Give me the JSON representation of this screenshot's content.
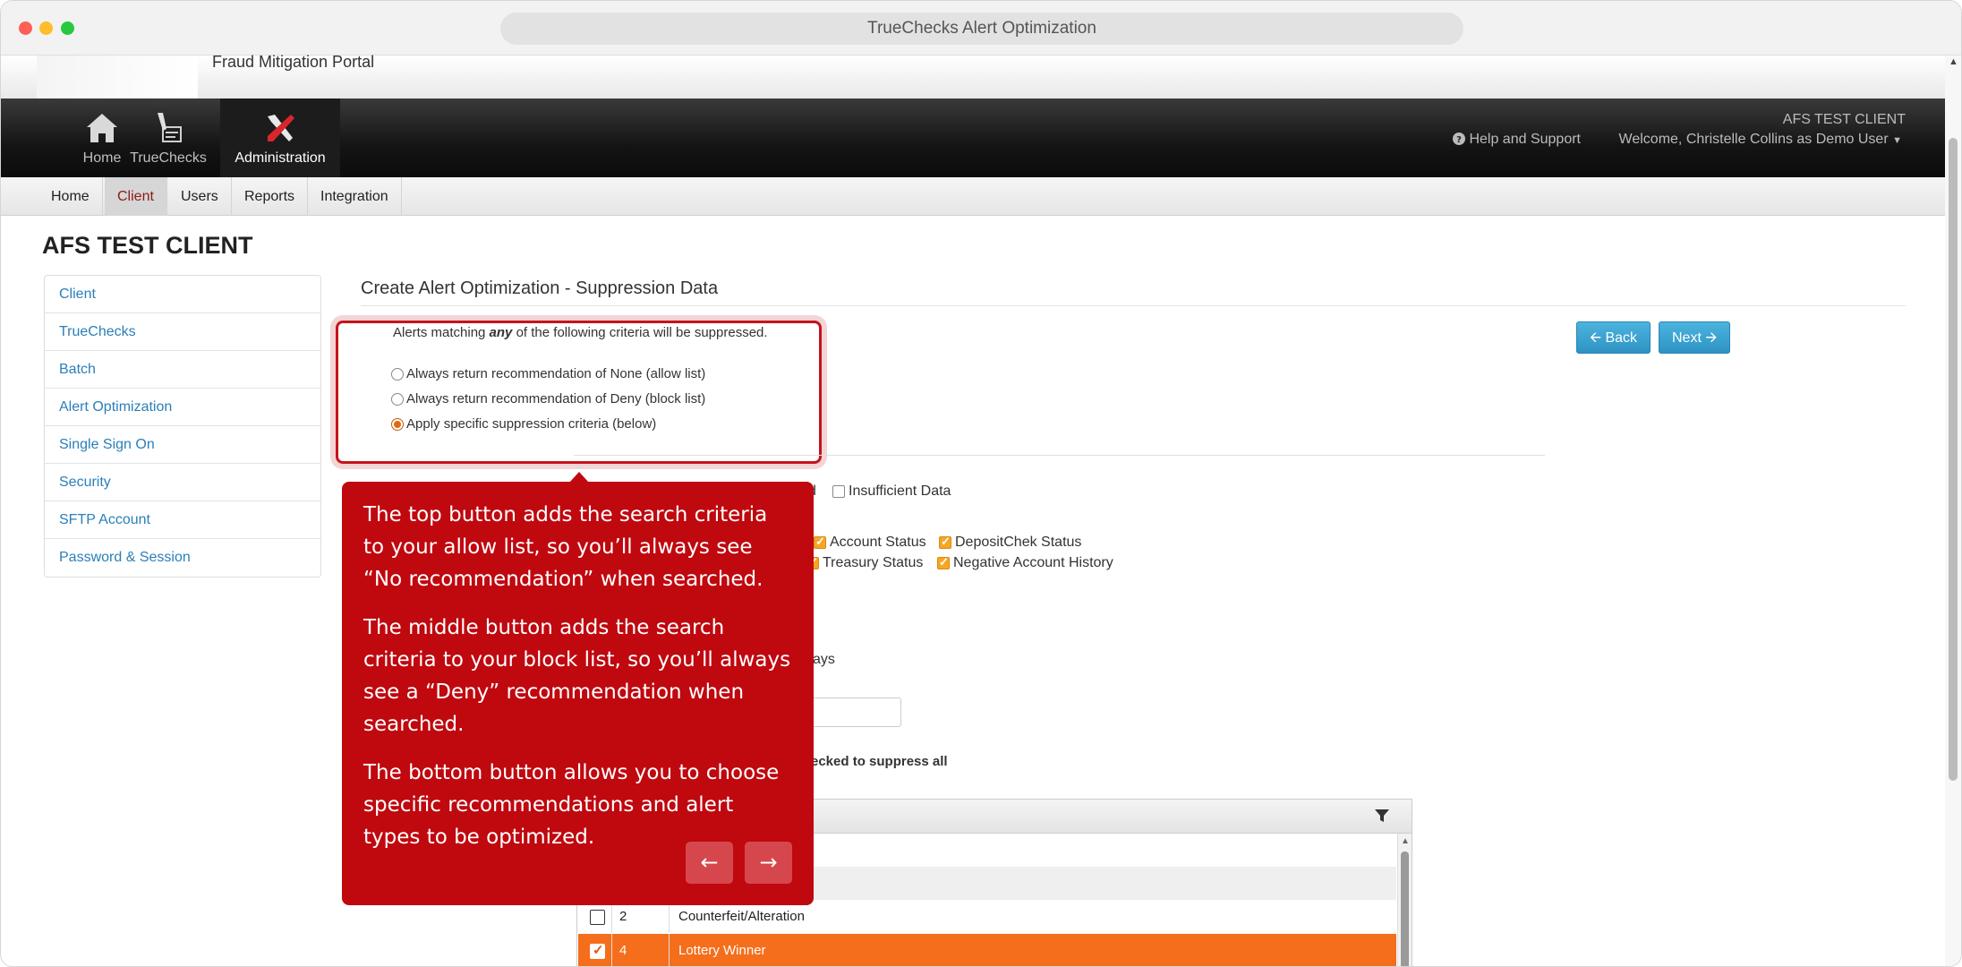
{
  "browser": {
    "title": "TrueChecks Alert Optimization"
  },
  "portal": {
    "name": "Fraud Mitigation Portal"
  },
  "topnav": {
    "items": [
      {
        "label": "Home",
        "icon": "home-icon"
      },
      {
        "label": "TrueChecks",
        "icon": "check-pen-icon"
      },
      {
        "label": "Administration",
        "icon": "tools-icon"
      }
    ],
    "client_name": "AFS TEST CLIENT",
    "help": "Help and Support",
    "welcome": "Welcome, Christelle Collins as Demo User"
  },
  "subnav": {
    "tabs": [
      "Home",
      "Client",
      "Users",
      "Reports",
      "Integration"
    ],
    "active": "Client"
  },
  "page": {
    "client_title": "AFS TEST CLIENT"
  },
  "sidebar": {
    "items": [
      "Client",
      "TrueChecks",
      "Batch",
      "Alert Optimization",
      "Single Sign On",
      "Security",
      "SFTP Account",
      "Password & Session"
    ]
  },
  "main": {
    "section_title": "Create Alert Optimization - Suppression Data",
    "criteria_note_prefix": "Alerts matching ",
    "criteria_note_em": "any",
    "criteria_note_suffix": " of the following criteria will be suppressed.",
    "radio_options": [
      {
        "label": "Always return recommendation of None (allow list)",
        "checked": false
      },
      {
        "label": "Always return recommendation of Deny (block list)",
        "checked": false
      },
      {
        "label": "Apply specific suppression criteria (below)",
        "checked": true
      }
    ],
    "back_label": "Back",
    "next_label": "Next",
    "fragments": {
      "d_suffix": "d",
      "insufficient_data": "Insufficient Data",
      "account_status": "Account Status",
      "depositchek_status": "DepositChek Status",
      "treasury_status": "Treasury Status",
      "negative_account_history": "Negative Account History",
      "days_suffix": "ays",
      "suppress_all_note": "ecked to suppress all"
    },
    "grid_rows": [
      {
        "code": "2",
        "name": "Counterfeit/Alteration",
        "checked": false
      },
      {
        "code": "4",
        "name": "Lottery Winner",
        "checked": true
      }
    ]
  },
  "tooltip": {
    "paragraphs": [
      "The top button adds the search criteria to your allow list, so you’ll always see “No recommendation” when searched.",
      "The middle button adds the search criteria to your block list, so you’ll always see a “Deny” recommendation when searched.",
      "The bottom button allows you to choose specific recommendations and alert types to be optimized."
    ],
    "prev_icon": "arrow-left-icon",
    "next_icon": "arrow-right-icon"
  },
  "colors": {
    "accent_red": "#c0080f",
    "link_blue": "#2a7fb8",
    "button_blue": "#2e93c3",
    "selected_row": "#f46e1b"
  }
}
